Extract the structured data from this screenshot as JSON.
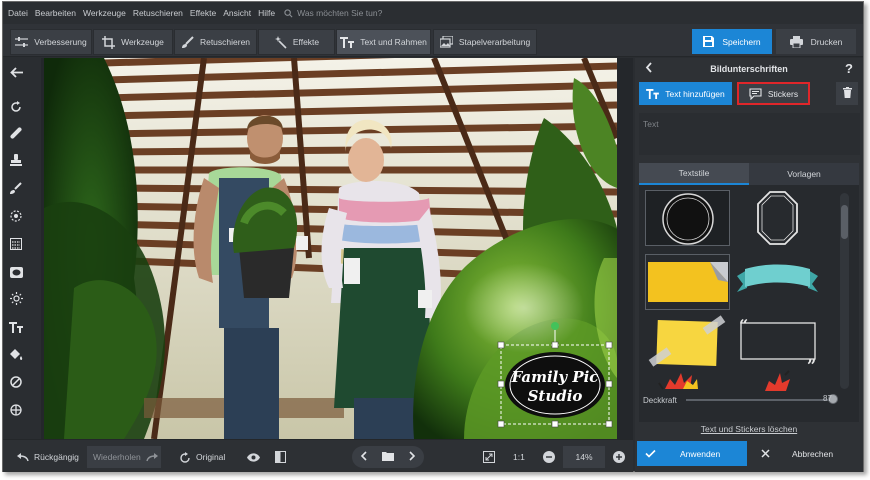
{
  "menu": {
    "items": [
      "Datei",
      "Bearbeiten",
      "Werkzeuge",
      "Retuschieren",
      "Effekte",
      "Ansicht",
      "Hilfe"
    ],
    "search_placeholder": "Was möchten Sie tun?"
  },
  "toolbar": {
    "enhance": "Verbesserung",
    "tools": "Werkzeuge",
    "retouch": "Retuschieren",
    "effects": "Effekte",
    "text_frames": "Text und Rahmen",
    "batch": "Stapelverarbeitung",
    "save": "Speichern",
    "print": "Drucken"
  },
  "canvas": {
    "caption_line1": "Family Pic",
    "caption_line2": "Studio"
  },
  "bottombar": {
    "undo": "Rückgängig",
    "redo": "Wiederholen",
    "original": "Original",
    "ratio": "1:1",
    "zoom": "14%"
  },
  "panel": {
    "title": "Bildunterschriften",
    "help": "?",
    "add_text": "Text hinzufügen",
    "stickers": "Stickers",
    "text_placeholder": "Text",
    "tab_styles": "Textstile",
    "tab_templates": "Vorlagen",
    "opacity_label": "Deckkraft",
    "opacity_value": "87",
    "clear_link": "Text und Stickers löschen",
    "apply": "Anwenden",
    "cancel": "Abbrechen"
  },
  "colors": {
    "accent": "#1c86d6",
    "highlight": "#e0262a",
    "panel_bg": "#2e3135"
  }
}
